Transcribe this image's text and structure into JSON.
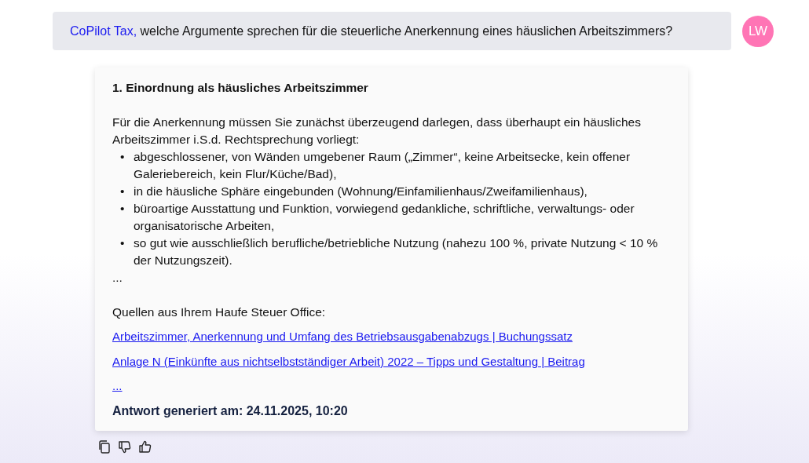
{
  "question": {
    "mention": "CoPilot Tax,",
    "text": "welche Argumente sprechen für die steuerliche Anerkennung eines häuslichen Arbeitszimmers?"
  },
  "avatar": {
    "initials": "LW",
    "color": "#ff75b5"
  },
  "answer": {
    "heading": "1. Einordnung als häusliches Arbeitszimmer",
    "intro": "Für die Anerkennung müssen Sie zunächst überzeugend darlegen, dass  überhaupt ein häusliches Arbeitszimmer i.S.d. Rechtsprechung vorliegt:",
    "bullet_marker": "•",
    "bullets": [
      "abgeschlossener, von Wänden umgebener Raum („Zimmer“, keine Arbeitsecke, kein offener Galeriebereich, kein Flur/Küche/Bad),",
      "in die häusliche Sphäre eingebunden (Wohnung/Einfamilienhaus/Zweifamilienhaus),",
      "büroartige Ausstattung und Funktion, vorwiegend gedankliche, schriftliche, verwaltungs- oder organisatorische Arbeiten,",
      "so gut wie ausschließlich berufliche/betriebliche Nutzung (nahezu 100 %, private Nutzung < 10 % der Nutzungszeit)."
    ],
    "ellipsis": "...",
    "sources_label": "Quellen aus Ihrem Haufe Steuer Office:",
    "sources": [
      "Arbeitszimmer, Anerkennung und Umfang des Betriebsausgabenabzugs | Buchungssatz",
      "Anlage N (Einkünfte aus nichtselbstständiger Arbeit) 2022 – Tipps und Gestaltung | Beitrag",
      "..."
    ],
    "generated": "Antwort generiert am: 24.11.2025, 10:20"
  },
  "actions": [
    {
      "kind": "copy"
    },
    {
      "kind": "thumbs_down"
    },
    {
      "kind": "thumbs_up"
    }
  ]
}
